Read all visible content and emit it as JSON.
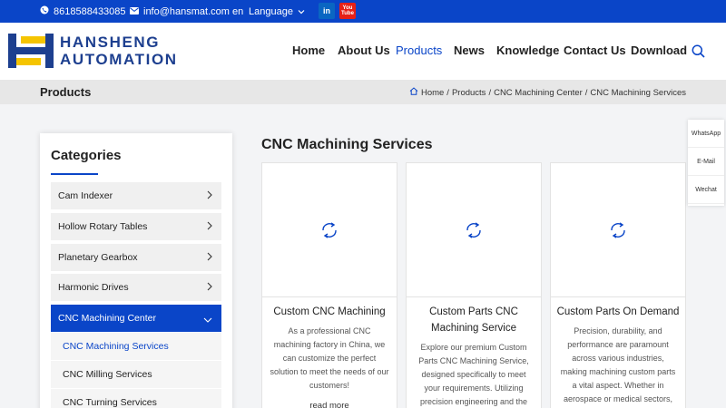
{
  "topbar": {
    "phone": "8618588433085",
    "email": "info@hansmat.com",
    "lang_code": "en",
    "language_label": "Language",
    "social": [
      {
        "name": "linkedin-icon",
        "glyph": "in",
        "color": "#0a66c2"
      },
      {
        "name": "youtube-icon",
        "glyph": "You Tube",
        "color": "#e62117"
      }
    ]
  },
  "brand": {
    "line1": "HANSHENG",
    "line2": "AUTOMATION",
    "color": "#1d3f8f",
    "accent": "#f5c400"
  },
  "nav": {
    "items": [
      {
        "label": "Home"
      },
      {
        "label": "About Us"
      },
      {
        "label": "Products"
      },
      {
        "label": "News"
      },
      {
        "label": "Knowledge"
      },
      {
        "label": "Contact Us"
      },
      {
        "label": "Download"
      }
    ],
    "active": "Products"
  },
  "page_header": {
    "title": "Products",
    "breadcrumb": [
      "Home",
      "Products",
      "CNC Machining Center",
      "CNC Machining Services"
    ],
    "separator": "/"
  },
  "sidebar": {
    "title": "Categories",
    "categories": [
      {
        "label": "Cam Indexer"
      },
      {
        "label": "Hollow Rotary Tables"
      },
      {
        "label": "Planetary Gearbox"
      },
      {
        "label": "Harmonic Drives"
      },
      {
        "label": "CNC Machining Center"
      }
    ],
    "subcategories": [
      {
        "label": "CNC Machining Services"
      },
      {
        "label": "CNC Milling Services"
      },
      {
        "label": "CNC Turning Services"
      }
    ]
  },
  "main": {
    "title": "CNC Machining Services",
    "cards": [
      {
        "title": "Custom CNC Machining",
        "desc": "As a professional CNC machining factory in China, we can customize the perfect solution to meet the needs of our customers!",
        "more": "read more"
      },
      {
        "title": "Custom Parts CNC Machining Service",
        "desc": "Explore our premium Custom Parts CNC Machining Service, designed specifically to meet your requirements. Utilizing precision engineering and the",
        "more": ""
      },
      {
        "title": "Custom Parts On Demand",
        "desc": "Precision, durability, and performance are paramount across various industries, making machining custom parts a vital aspect. Whether in aerospace or medical sectors,",
        "more": ""
      }
    ]
  },
  "float_contacts": [
    {
      "label": "WhatsApp"
    },
    {
      "label": "E-Mail"
    },
    {
      "label": "Wechat"
    }
  ],
  "colors": {
    "primary": "#0a45c8",
    "band": "#e7e7e7"
  }
}
